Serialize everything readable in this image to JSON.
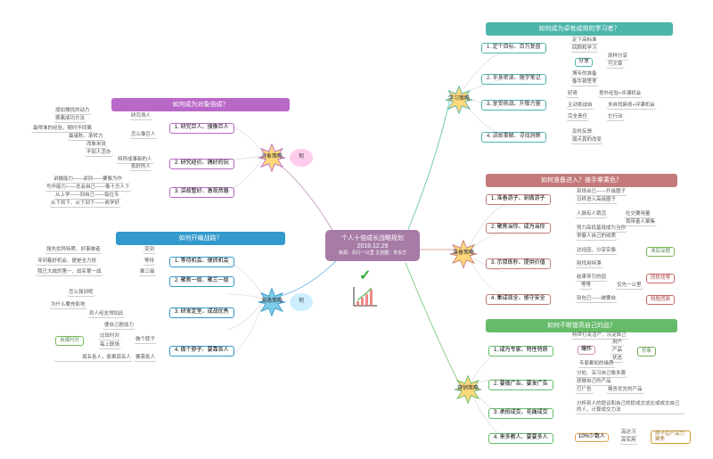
{
  "center": {
    "title": "个人十倍成长战略规划",
    "date": "2019.12.29",
    "source": "来源：先行一公里   主创圈：朱东方"
  },
  "sections": {
    "learn": {
      "header": "如何成为卓有成效的学习者？",
      "burst": "学习策略",
      "items": [
        {
          "label": "1. 定个目标、百万复盘",
          "leaves": [
            "定下高标准",
            "回顾和学习"
          ],
          "sub": [
            {
              "label": "分享",
              "leaves": [
                "原样分享",
                "可文章"
              ]
            }
          ]
        },
        {
          "label": "2. 半身密读、随学笔记",
          "leaves": [
            "博专的准备",
            "像牛顿思考"
          ]
        },
        {
          "label": "3. 享受挑战、升敬力量",
          "sub": [
            {
              "label": "好奇",
              "leaves": [
                "意外经验+评课机会"
              ]
            },
            {
              "label": "主动挑战自",
              "leaves": [
                "多自找麻烦+评课机会"
              ]
            },
            {
              "label": "完全责任",
              "leaves": [
                "它行动"
              ]
            }
          ]
        },
        {
          "label": "4. 讲故事解、寻找洞察",
          "leaves": [
            "及时反馈",
            "弱点真的改变"
          ]
        }
      ]
    },
    "thing": {
      "header": "如何成为对象倍成？",
      "burst": "对象策略",
      "circle": "何",
      "items": [
        {
          "label": "1. 研究巨人、搜像巨人",
          "leaves": [
            "增加搜找的动力",
            "换离成功方法",
            "最得准的经验，随时不同离",
            "最诸秋、承转力",
            "改象米说",
            "不如人怎办"
          ],
          "sub": [
            {
              "label": "研究场人",
              "leaves": []
            },
            {
              "label": "怎么像巨人",
              "leaves": []
            }
          ]
        },
        {
          "label": "2. 研究经价、偶好的玩",
          "leaves": [
            "特异成事新的人",
            "抵好的人"
          ]
        },
        {
          "label": "3. 讲故整好、激视然路",
          "leaves": [
            "讲摄能力——讲到——要像为作",
            "写作能力——总会自己——像十方人下",
            "从上学——到自己——每位专",
            "从下到下、从下到下——收学好"
          ]
        }
      ]
    },
    "prep": {
      "header": "如何准备进入？被手拿乘色？",
      "burst": "准备策略",
      "items": [
        {
          "label": "1. 准备游子、刻做游子",
          "leaves": [
            "到场台已——升级圈子",
            "日终进入高级圈子"
          ]
        },
        {
          "label": "2. 聚焦当你、成为当你",
          "leaves": [
            "人脉有人销活",
            "努力高低基就成为当你",
            "常春人自己的收质"
          ],
          "sub": [
            {
              "label": "社交要用量",
              "leaves": []
            },
            {
              "label": "我带善人聚集",
              "leaves": []
            }
          ]
        },
        {
          "label": "3. 示双练秒、提供价值",
          "leaves": [
            "达经因、分享实像",
            "别找用特漂",
            "结果导引的因",
            "等等",
            "仅先一公里"
          ],
          "tags": [
            {
              "text": "清后深题",
              "color": "#7b5"
            },
            {
              "text": "同阶找等",
              "color": "#c66"
            }
          ]
        },
        {
          "label": "4. 集成效全、留守安全",
          "leaves": [
            "别包已——被要自"
          ],
          "tag": {
            "text": "侧脸团面",
            "color": "#c66"
          }
        }
      ]
    },
    "road": {
      "header": "如何开编战路？",
      "burst": "发路策略",
      "circle": "何",
      "items": [
        {
          "label": "1. 等待机会、便抓机会",
          "leaves": [
            "强先优异特质、好事做者",
            "寻到着好机会、便是全力抢",
            "我已大成的第一、战名第一战"
          ],
          "sub": [
            {
              "label": "变到",
              "leaves": []
            },
            {
              "label": "等待",
              "leaves": []
            },
            {
              "label": "聚三级",
              "leaves": []
            }
          ]
        },
        {
          "label": "2. 聚焦一级、聚三一级",
          "leaves": []
        },
        {
          "label": "3. 研发定室、成战优秀",
          "leaves": [
            "怎么强到呢",
            "为什么要充影地",
            "到人经支领加此",
            "便自己剧加力"
          ]
        },
        {
          "label": "4. 做个脖子、要靠各人",
          "leaves": [
            "比较时对",
            "每上联场",
            "要需各人"
          ],
          "sub": [
            {
              "label": "自媒时对",
              "leaves": []
            },
            {
              "label": "做个脖子",
              "leaves": []
            }
          ],
          "tag": {
            "text": "自媒时对",
            "color": "#7b5"
          }
        }
      ]
    },
    "market": {
      "header": "如何不断提高自己的品？",
      "burst": "营销策略",
      "items": [
        {
          "label": "1. 成为专家、特性特质",
          "leaves": [
            "特世打关活产、沉淀自己",
            "专家都知的缘质"
          ],
          "sub": [
            {
              "label": "爆炸",
              "leaves": [
                "用户",
                "产品",
                "状态"
              ]
            }
          ],
          "tag": {
            "text": "形象",
            "color": "#7a5"
          }
        },
        {
          "label": "2. 要做广告、要发广告",
          "leaves": [
            "分处、深习自己像多骤",
            "原做自己的产品",
            "打广告",
            "格答优先的产品"
          ]
        },
        {
          "label": "3. 承拍成交、花痛成交",
          "leaves": [
            "分析别人的提议和自己的拒成交这比或成交自己的人，计算成交力法"
          ]
        },
        {
          "label": "4. 来多教人、要要多人",
          "leaves": [
            "10%少数人"
          ],
          "sub": [
            {
              "label": "高达习",
              "leaves": []
            },
            {
              "label": "高实用",
              "leaves": []
            }
          ],
          "tag": {
            "text": "例子站产品力聚焦",
            "color": "#c93"
          }
        }
      ]
    }
  }
}
